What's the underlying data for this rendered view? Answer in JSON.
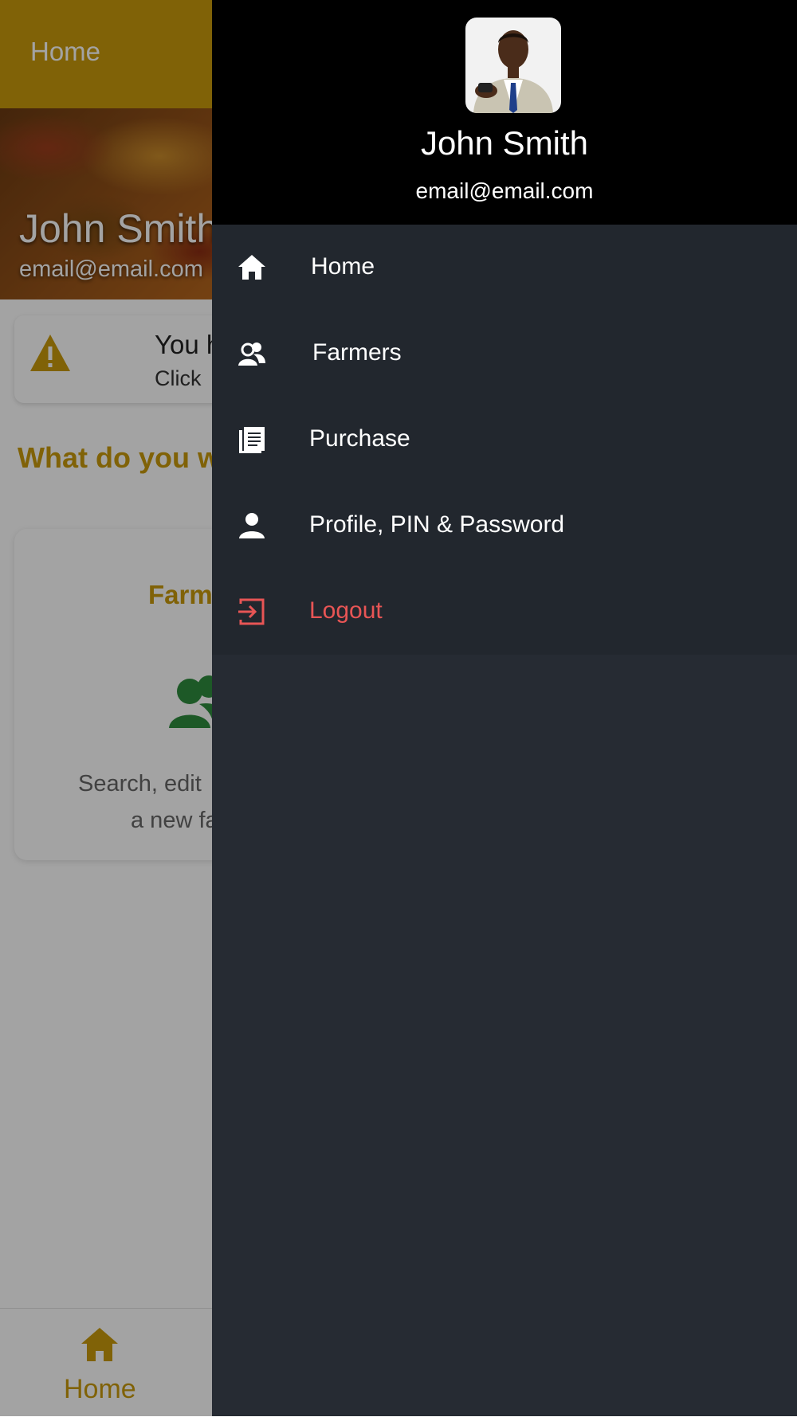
{
  "app": {
    "topbar_title": "Home",
    "hero": {
      "name": "John Smith",
      "email": "email@email.com"
    },
    "notice": {
      "title": "You h",
      "subtitle": "Click"
    },
    "question": "What do you w",
    "card": {
      "title": "Farm",
      "description_line1": "Search, edit",
      "description_line2": "a new fa"
    },
    "bottom_nav": {
      "home_label": "Home"
    }
  },
  "drawer": {
    "profile": {
      "name": "John Smith",
      "email": "email@email.com"
    },
    "menu": [
      {
        "label": "Home",
        "icon": "home-icon"
      },
      {
        "label": "Farmers",
        "icon": "farmers-icon"
      },
      {
        "label": "Purchase",
        "icon": "document-icon"
      },
      {
        "label": "Profile, PIN & Password",
        "icon": "person-icon"
      },
      {
        "label": "Logout",
        "icon": "logout-icon"
      }
    ]
  },
  "colors": {
    "brand": "#c99a0b",
    "drawer_bg": "#262b33",
    "drawer_header_bg": "#000000",
    "logout": "#e85555",
    "card_icon": "#2e8b3e"
  }
}
